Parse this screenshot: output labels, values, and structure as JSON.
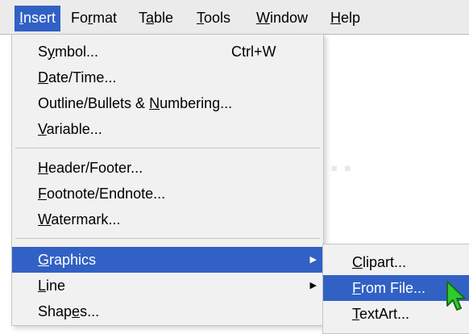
{
  "menubar": {
    "items": [
      {
        "pre": "",
        "u": "I",
        "post": "nsert"
      },
      {
        "pre": "Fo",
        "u": "r",
        "post": "mat"
      },
      {
        "pre": "T",
        "u": "a",
        "post": "ble"
      },
      {
        "pre": "",
        "u": "T",
        "post": "ools"
      },
      {
        "pre": "",
        "u": "W",
        "post": "indow"
      },
      {
        "pre": "",
        "u": "H",
        "post": "elp"
      }
    ]
  },
  "insert_menu": {
    "items": [
      {
        "pre": "S",
        "u": "y",
        "post": "mbol...",
        "shortcut": "Ctrl+W"
      },
      {
        "pre": "",
        "u": "D",
        "post": "ate/Time..."
      },
      {
        "pre": "Outline/Bullets & ",
        "u": "N",
        "post": "umbering..."
      },
      {
        "pre": "",
        "u": "V",
        "post": "ariable..."
      },
      {
        "pre": "",
        "u": "H",
        "post": "eader/Footer..."
      },
      {
        "pre": "",
        "u": "F",
        "post": "ootnote/Endnote..."
      },
      {
        "pre": "",
        "u": "W",
        "post": "atermark..."
      },
      {
        "pre": "",
        "u": "G",
        "post": "raphics"
      },
      {
        "pre": "",
        "u": "L",
        "post": "ine"
      },
      {
        "pre": "Shap",
        "u": "e",
        "post": "s..."
      }
    ]
  },
  "graphics_submenu": {
    "items": [
      {
        "pre": "",
        "u": "C",
        "post": "lipart..."
      },
      {
        "pre": "",
        "u": "F",
        "post": "rom File..."
      },
      {
        "pre": "",
        "u": "T",
        "post": "extArt..."
      }
    ]
  },
  "colors": {
    "highlight": "#3161c5",
    "menu_bg": "#f1f1f1",
    "cursor_fill": "#2ecc2e"
  },
  "icons": {
    "submenu_arrow": "submenu-arrow-icon",
    "cursor": "mouse-pointer-icon"
  }
}
